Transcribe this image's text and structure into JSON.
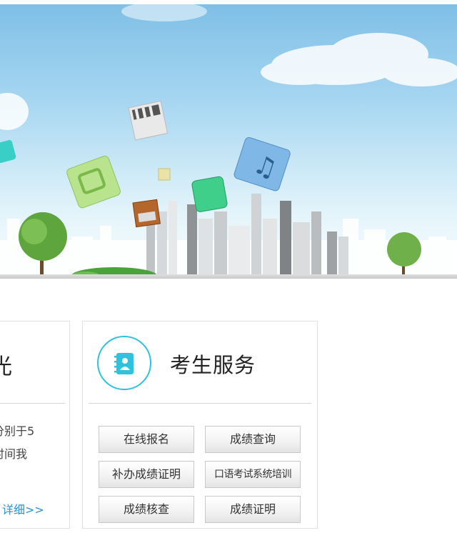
{
  "left_card": {
    "title_fragment": "光",
    "line1": "分别于5",
    "line2": "时间我",
    "more_link": "详细>>"
  },
  "service_card": {
    "icon": "contact-book-icon",
    "title": "考生服务",
    "buttons": [
      {
        "label": "在线报名"
      },
      {
        "label": "成绩查询"
      },
      {
        "label": "补办成绩证明"
      },
      {
        "label": "口语考试系统培训"
      },
      {
        "label": "成绩核查"
      },
      {
        "label": "成绩证明"
      }
    ]
  },
  "colors": {
    "accent_cyan": "#2ec2dc",
    "link_blue": "#2a93d5",
    "border_gray": "#e1e1e1"
  }
}
